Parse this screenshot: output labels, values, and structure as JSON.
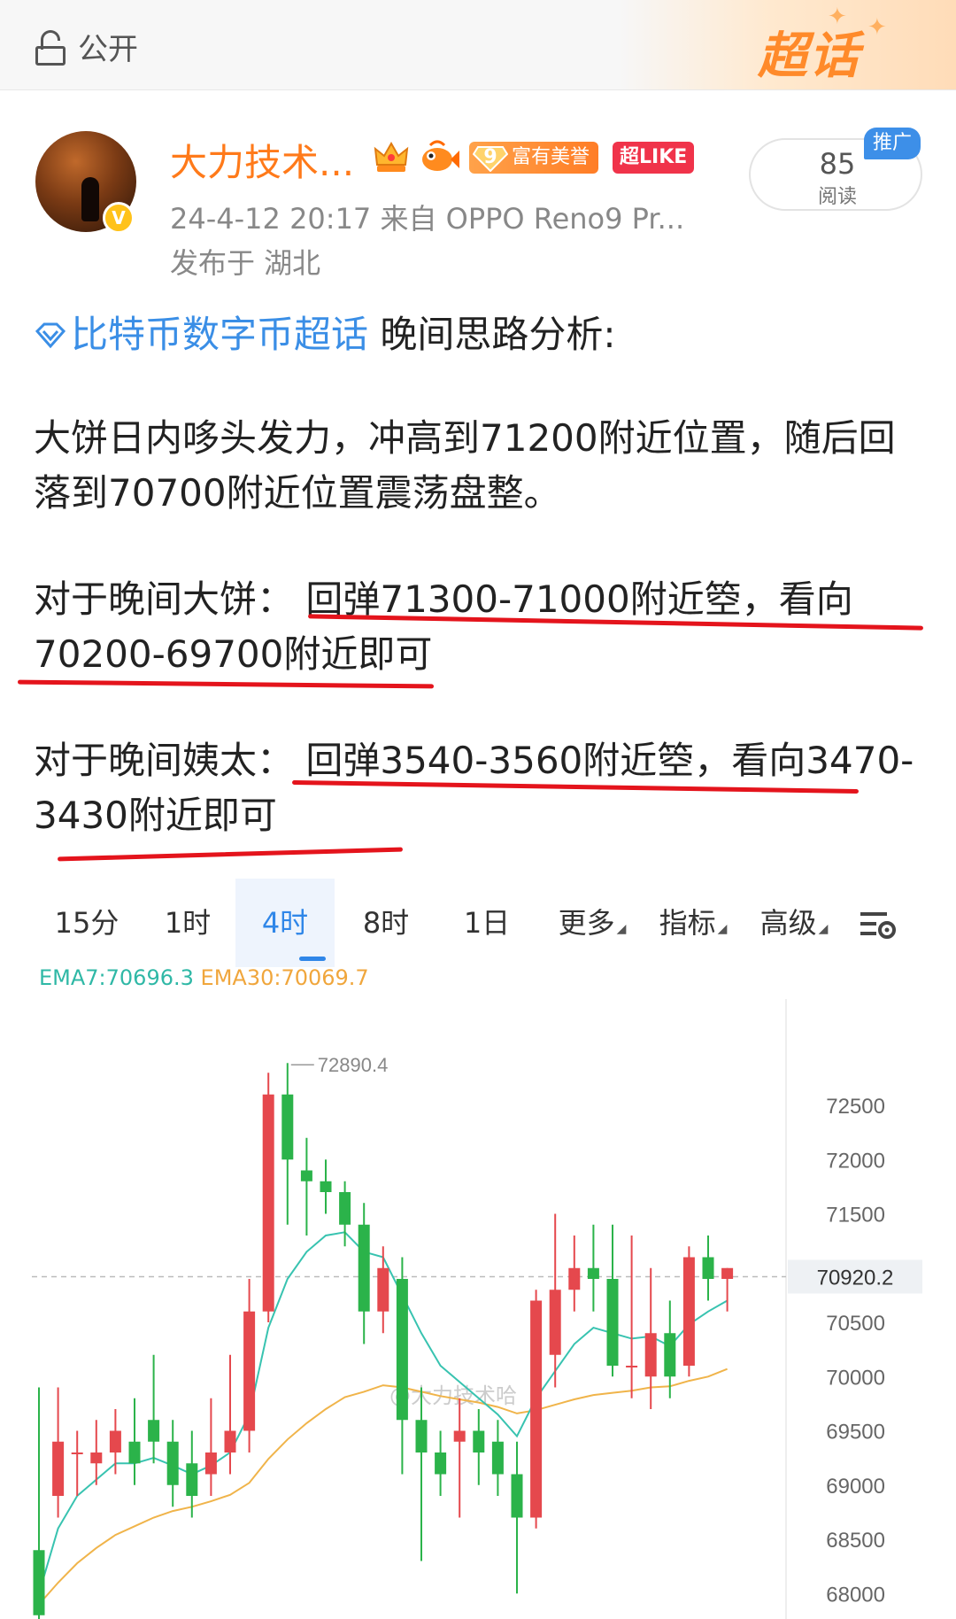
{
  "topbar": {
    "visibility_label": "公开",
    "super_topic_label": "超话"
  },
  "post": {
    "author": "大力技术...",
    "honor_level": "9",
    "honor_label": "富有美誉",
    "like_badge": "超LIKE",
    "meta": "24-4-12 20:17   来自 OPPO Reno9 Pr...",
    "location": "发布于 湖北",
    "read_count": "85",
    "read_label": "阅读",
    "promo_tag": "推广",
    "avatar_badge": "V"
  },
  "content": {
    "topic_link": "比特币数字币超话",
    "topic_rest": " 晚间思路分析:",
    "para1": "大饼日内哆头发力，冲高到71200附近位置，随后回落到70700附近位置震荡盘整。",
    "para2": "对于晚间大饼： 回弹71300-71000附近箜，看向70200-69700附近即可",
    "para3": "对于晚间姨太： 回弹3540-3560附近箜，看向3470-3430附近即可"
  },
  "chart_tabs": [
    {
      "label": "15分"
    },
    {
      "label": "1时"
    },
    {
      "label": "4时",
      "active": true
    },
    {
      "label": "8时"
    },
    {
      "label": "1日"
    },
    {
      "label": "更多"
    },
    {
      "label": "指标"
    },
    {
      "label": "高级"
    }
  ],
  "chart_settings_icon": "chart-settings-icon",
  "chart_data": {
    "type": "candlestick",
    "indicators": {
      "ema7_label": "EMA7:70696.3",
      "ema30_label": "EMA30:70069.7"
    },
    "y_ticks": [
      "72500",
      "72000",
      "71500",
      "70500",
      "70000",
      "69500",
      "69000",
      "68500",
      "68000"
    ],
    "ylim": [
      67900,
      73200
    ],
    "high_marker": "72890.4",
    "current_price": "70920.2",
    "watermark": "@大力技术哈",
    "candles": [
      {
        "o": 68400,
        "c": 67800,
        "h": 69900,
        "l": 67700
      },
      {
        "o": 68900,
        "c": 69400,
        "h": 69900,
        "l": 68700
      },
      {
        "o": 69300,
        "c": 69300,
        "h": 69500,
        "l": 68900
      },
      {
        "o": 69200,
        "c": 69300,
        "h": 69600,
        "l": 69000
      },
      {
        "o": 69300,
        "c": 69500,
        "h": 69700,
        "l": 69100
      },
      {
        "o": 69400,
        "c": 69200,
        "h": 69800,
        "l": 69000
      },
      {
        "o": 69600,
        "c": 69400,
        "h": 70200,
        "l": 69200
      },
      {
        "o": 69400,
        "c": 69000,
        "h": 69600,
        "l": 68800
      },
      {
        "o": 69200,
        "c": 68900,
        "h": 69500,
        "l": 68700
      },
      {
        "o": 69100,
        "c": 69300,
        "h": 69800,
        "l": 68900
      },
      {
        "o": 69300,
        "c": 69500,
        "h": 70200,
        "l": 69100
      },
      {
        "o": 69500,
        "c": 70600,
        "h": 70900,
        "l": 69300
      },
      {
        "o": 70600,
        "c": 72600,
        "h": 72800,
        "l": 70500
      },
      {
        "o": 72600,
        "c": 72000,
        "h": 72890,
        "l": 71400
      },
      {
        "o": 71900,
        "c": 71800,
        "h": 72200,
        "l": 71300
      },
      {
        "o": 71800,
        "c": 71700,
        "h": 72000,
        "l": 71500
      },
      {
        "o": 71700,
        "c": 71400,
        "h": 71800,
        "l": 71200
      },
      {
        "o": 71400,
        "c": 70600,
        "h": 71600,
        "l": 70300
      },
      {
        "o": 70600,
        "c": 71000,
        "h": 71200,
        "l": 70400
      },
      {
        "o": 70900,
        "c": 69600,
        "h": 71100,
        "l": 69100
      },
      {
        "o": 69600,
        "c": 69300,
        "h": 69900,
        "l": 68300
      },
      {
        "o": 69300,
        "c": 69100,
        "h": 69500,
        "l": 68900
      },
      {
        "o": 69400,
        "c": 69500,
        "h": 69800,
        "l": 68700
      },
      {
        "o": 69500,
        "c": 69300,
        "h": 69700,
        "l": 69000
      },
      {
        "o": 69400,
        "c": 69100,
        "h": 69600,
        "l": 68900
      },
      {
        "o": 69100,
        "c": 68700,
        "h": 69400,
        "l": 68000
      },
      {
        "o": 68700,
        "c": 70700,
        "h": 70800,
        "l": 68600
      },
      {
        "o": 70200,
        "c": 70800,
        "h": 71500,
        "l": 69900
      },
      {
        "o": 70800,
        "c": 71000,
        "h": 71300,
        "l": 70600
      },
      {
        "o": 71000,
        "c": 70900,
        "h": 71400,
        "l": 70600
      },
      {
        "o": 70900,
        "c": 70100,
        "h": 71400,
        "l": 70000
      },
      {
        "o": 70100,
        "c": 70100,
        "h": 71300,
        "l": 69800
      },
      {
        "o": 70000,
        "c": 70400,
        "h": 71000,
        "l": 69700
      },
      {
        "o": 70400,
        "c": 70000,
        "h": 70700,
        "l": 69800
      },
      {
        "o": 70100,
        "c": 71100,
        "h": 71200,
        "l": 70000
      },
      {
        "o": 71100,
        "c": 70900,
        "h": 71300,
        "l": 70700
      },
      {
        "o": 70900,
        "c": 71000,
        "h": 71000,
        "l": 70600
      }
    ],
    "ema7": [
      68000,
      68600,
      68900,
      69050,
      69200,
      69200,
      69250,
      69180,
      69100,
      69180,
      69300,
      69650,
      70450,
      70900,
      71150,
      71300,
      71330,
      71150,
      71100,
      70750,
      70400,
      70100,
      69950,
      69800,
      69650,
      69450,
      69800,
      70050,
      70300,
      70450,
      70400,
      70350,
      70370,
      70280,
      70480,
      70600,
      70700
    ],
    "ema30": [
      67900,
      68100,
      68280,
      68420,
      68540,
      68620,
      68700,
      68760,
      68800,
      68850,
      68910,
      69020,
      69240,
      69420,
      69570,
      69700,
      69810,
      69860,
      69920,
      69900,
      69860,
      69820,
      69790,
      69760,
      69720,
      69660,
      69690,
      69740,
      69790,
      69830,
      69850,
      69870,
      69900,
      69910,
      69960,
      70000,
      70070
    ]
  }
}
